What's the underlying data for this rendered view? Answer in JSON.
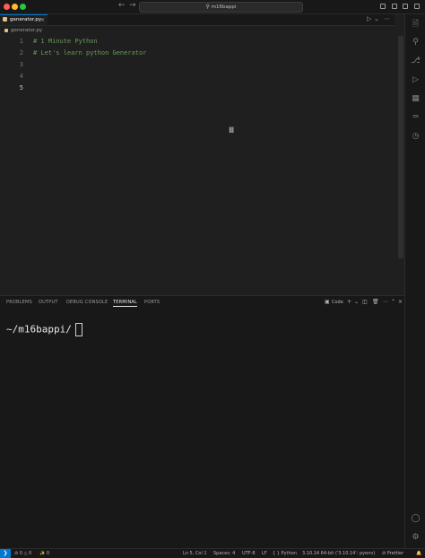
{
  "titlebar": {
    "search": "m16bappi",
    "back_icon": "←",
    "forward_icon": "→"
  },
  "tab": {
    "label": "generator.py",
    "close": "×"
  },
  "breadcrumb": {
    "file": "generator.py"
  },
  "editor": {
    "lines": [
      {
        "number": "1",
        "text": "# 1 Minute Python"
      },
      {
        "number": "2",
        "text": "# Let's learn python Generator"
      },
      {
        "number": "3",
        "text": ""
      },
      {
        "number": "4",
        "text": ""
      },
      {
        "number": "5",
        "text": ""
      }
    ]
  },
  "panel": {
    "tabs": [
      "PROBLEMS",
      "OUTPUT",
      "DEBUG CONSOLE",
      "TERMINAL",
      "PORTS"
    ],
    "active_tab": "TERMINAL",
    "terminal_profile": "Code",
    "prompt_symbol": "",
    "prompt_path": "~/m16bappi/"
  },
  "status": {
    "errors": "0",
    "warnings": "0",
    "ports": "0",
    "position": "Ln 5, Col 1",
    "spaces": "Spaces: 4",
    "encoding": "UTF-8",
    "eol": "LF",
    "language": "Python",
    "interpreter": "3.10.14 64-bit ('3.10.14': pyenv)",
    "formatter": "Prettier"
  },
  "colors": {
    "accent": "#0078d4",
    "comment": "#6a9955",
    "apple": "#b05cd6",
    "close_dot": "#ff5f57",
    "min_dot": "#febc2e",
    "max_dot": "#28c840"
  }
}
